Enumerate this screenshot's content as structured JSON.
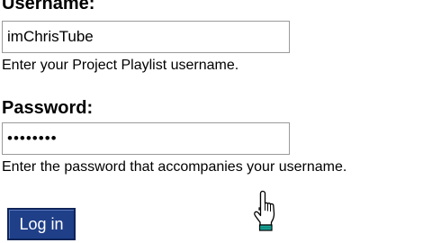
{
  "login_form": {
    "username": {
      "label": "Username:",
      "value": "imChrisTube",
      "hint": "Enter your Project Playlist username."
    },
    "password": {
      "label": "Password:",
      "masked_value": "••••••••",
      "hint": "Enter the password that accompanies your username."
    },
    "submit_label": "Log in"
  },
  "cursor": {
    "icon": "hand-pointer-icon"
  },
  "colors": {
    "button_background": "#1f3f88",
    "button_text": "#ffffff",
    "input_border": "#9a9a9a",
    "page_background": "#ffffff"
  }
}
